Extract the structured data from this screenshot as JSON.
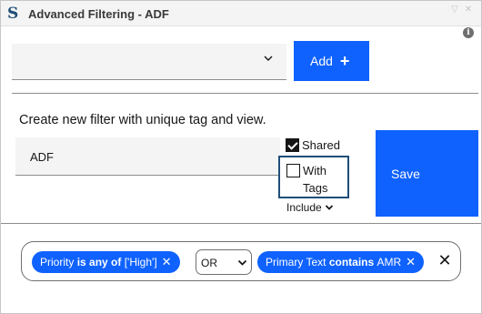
{
  "window": {
    "title": "Advanced Filtering - ADF",
    "logo_glyph": "S",
    "controls": [
      "▽",
      "✕"
    ],
    "info_glyph": "i"
  },
  "filter_row": {
    "select_value": "",
    "add_label": "Add",
    "add_icon": "+"
  },
  "create": {
    "instruction": "Create new filter with unique tag and view.",
    "name_value": "ADF",
    "shared_label": "Shared",
    "shared_checked": true,
    "with_tags_line1": "With",
    "with_tags_line2": "Tags",
    "with_tags_checked": false,
    "include_label": "Include",
    "save_label": "Save"
  },
  "chips": {
    "chip1": {
      "field": "Priority",
      "op": "is any of",
      "value": "['High']",
      "remove": "✕"
    },
    "operator": "OR",
    "chip2": {
      "field": "Primary Text",
      "op": "contains",
      "value": "AMR",
      "remove": "✕"
    },
    "clear_glyph": "✕"
  },
  "colors": {
    "primary": "#0f62fe",
    "focus_border": "#1f4e79",
    "field_bg": "#f4f4f4"
  },
  "icons": [
    "app-logo-icon",
    "info-icon",
    "chevron-down-icon",
    "plus-icon",
    "check-icon",
    "close-icon"
  ]
}
